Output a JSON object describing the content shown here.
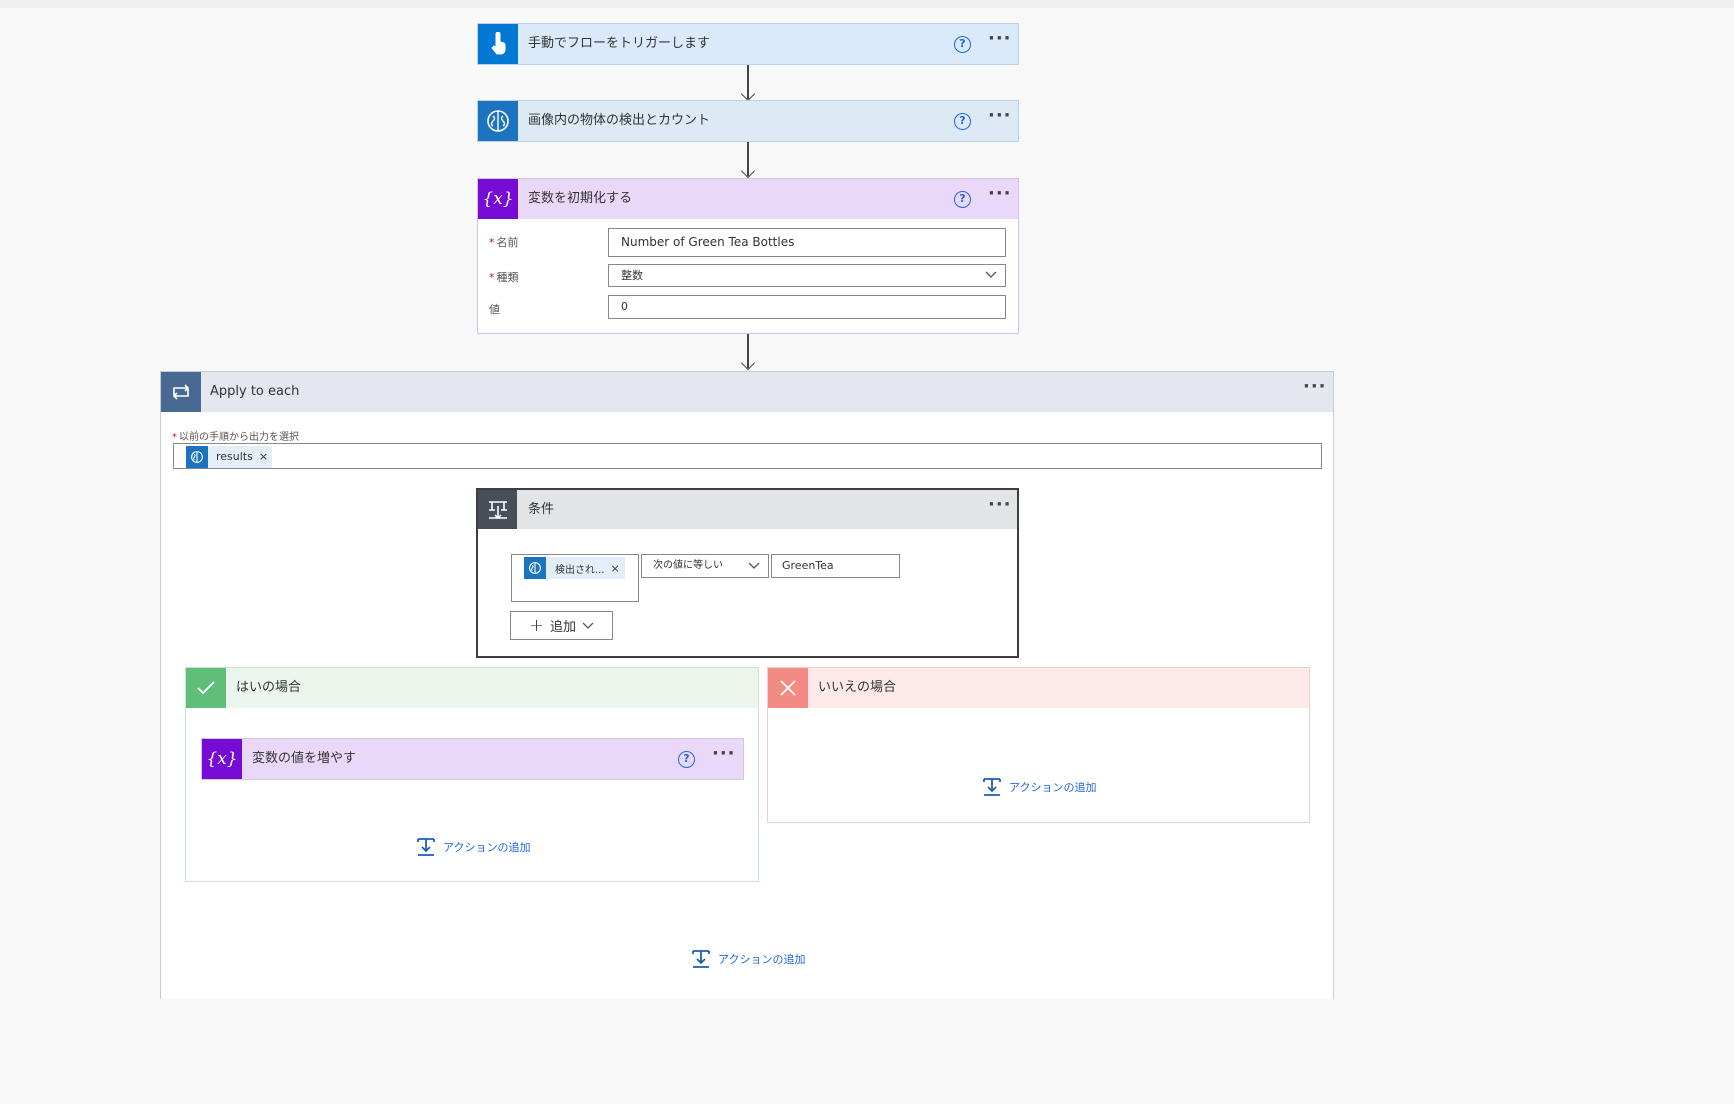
{
  "flow": {
    "trigger": {
      "title": "手動でフローをトリガーします",
      "color": "#0078d4",
      "head_bg": "#dbeafb",
      "icon": "touch-icon"
    },
    "vision": {
      "title": "画像内の物体の検出とカウント",
      "color": "#1c73c0",
      "head_bg": "#dde9f5",
      "icon": "brain-icon"
    },
    "init_var": {
      "title": "変数を初期化する",
      "color": "#770bd6",
      "head_bg": "#ead8f8",
      "icon_text": "{x}",
      "name_label": "名前",
      "name_value": "Number of Green Tea Bottles",
      "type_label": "種類",
      "type_value": "整数",
      "value_label": "値",
      "value_value": "0"
    },
    "loop": {
      "title": "Apply to each",
      "color": "#486991",
      "head_bg": "#e4e7ee",
      "select_label": "以前の手順から出力を選択",
      "token": "results",
      "token_close": "×"
    },
    "condition": {
      "title": "条件",
      "color": "#484f58",
      "head_bg": "#e3e4e6",
      "left_token": "検出され...",
      "left_token_close": "×",
      "operator": "次の値に等しい",
      "right_value": "GreenTea",
      "add_label": "追加"
    },
    "yes": {
      "title": "はいの場合",
      "color": "#5fbf79",
      "head_bg": "#eaf6ec",
      "increment": {
        "title": "変数の値を増やす",
        "icon_text": "{x}"
      },
      "add_action": "アクションの追加"
    },
    "no": {
      "title": "いいえの場合",
      "color": "#f28b84",
      "head_bg": "#fde9e8",
      "add_action": "アクションの追加"
    },
    "loop_add_action": "アクションの追加"
  }
}
